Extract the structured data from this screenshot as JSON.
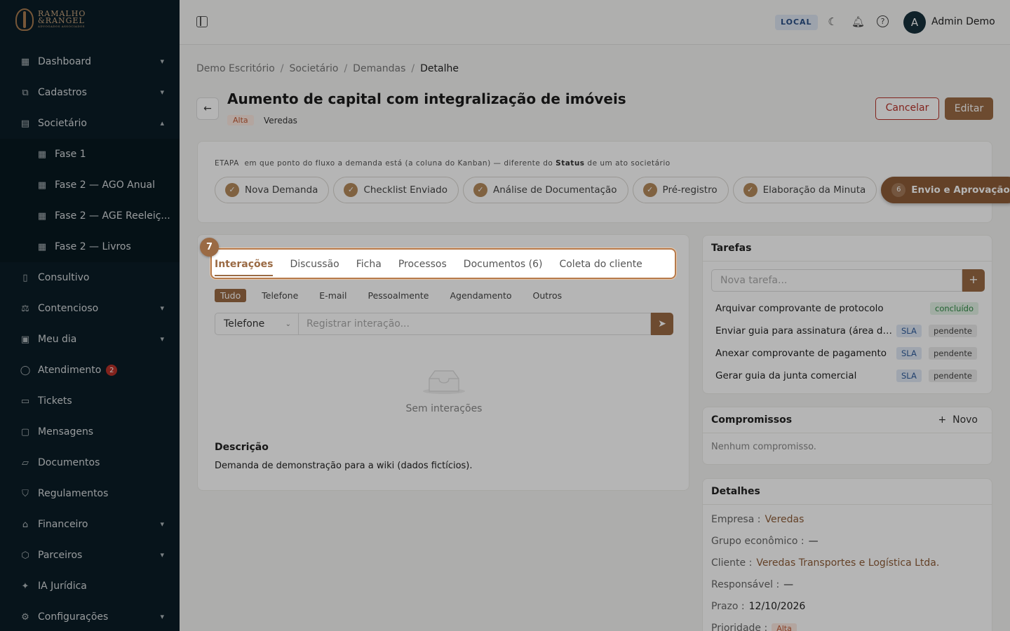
{
  "brand": {
    "line1": "RAMALHO",
    "line2": "&RANGEL",
    "tagline": "ADVOGADOS ASSOCIADOS"
  },
  "sidebar": {
    "items": [
      {
        "label": "Dashboard",
        "icon": "grid-icon",
        "chevron": "down"
      },
      {
        "label": "Cadastros",
        "icon": "boxes-icon",
        "chevron": "down"
      },
      {
        "label": "Societário",
        "icon": "building-icon",
        "chevron": "up"
      },
      {
        "label": "Fase 1",
        "icon": "grid-icon"
      },
      {
        "label": "Fase 2 — AGO Anual",
        "icon": "grid-icon"
      },
      {
        "label": "Fase 2 — AGE Reeleiç...",
        "icon": "grid-icon"
      },
      {
        "label": "Fase 2 — Livros",
        "icon": "grid-icon"
      },
      {
        "label": "Consultivo",
        "icon": "book-icon"
      },
      {
        "label": "Contencioso",
        "icon": "scale-icon",
        "chevron": "down"
      },
      {
        "label": "Meu dia",
        "icon": "calendar-icon",
        "chevron": "down"
      },
      {
        "label": "Atendimento",
        "icon": "chat-icon",
        "badge": "2"
      },
      {
        "label": "Tickets",
        "icon": "ticket-icon"
      },
      {
        "label": "Mensagens",
        "icon": "message-icon"
      },
      {
        "label": "Documentos",
        "icon": "folder-icon"
      },
      {
        "label": "Regulamentos",
        "icon": "shield-icon"
      },
      {
        "label": "Financeiro",
        "icon": "bank-icon",
        "chevron": "down"
      },
      {
        "label": "Parceiros",
        "icon": "handshake-icon",
        "chevron": "down"
      },
      {
        "label": "IA Jurídica",
        "icon": "sparkle-icon"
      },
      {
        "label": "Configurações",
        "icon": "gear-icon",
        "chevron": "down"
      }
    ]
  },
  "topbar": {
    "env": "LOCAL",
    "avatar_initial": "A",
    "user": "Admin Demo"
  },
  "breadcrumb": [
    "Demo Escritório",
    "Societário",
    "Demandas",
    "Detalhe"
  ],
  "header": {
    "title": "Aumento de capital com integralização de imóveis",
    "priority": "Alta",
    "company": "Veredas",
    "cancel": "Cancelar",
    "edit": "Editar"
  },
  "stage": {
    "note_prefix": "ETAPA",
    "note_mid": "em que ponto do fluxo a demanda está (a coluna do Kanban) — diferente do",
    "note_bold": "Status",
    "note_suffix": "de um ato societário",
    "steps": [
      {
        "label": "Nova Demanda",
        "mark": "✓"
      },
      {
        "label": "Checklist Enviado",
        "mark": "✓"
      },
      {
        "label": "Análise de Documentação",
        "mark": "✓"
      },
      {
        "label": "Pré-registro",
        "mark": "✓"
      },
      {
        "label": "Elaboração da Minuta",
        "mark": "✓"
      },
      {
        "label": "Envio e Aprovação",
        "mark": "6",
        "active": true
      }
    ]
  },
  "tabs": [
    "Interações",
    "Discussão",
    "Ficha",
    "Processos",
    "Documentos (6)",
    "Coleta do cliente"
  ],
  "tour_step": "7",
  "filters": [
    "Tudo",
    "Telefone",
    "E-mail",
    "Pessoalmente",
    "Agendamento",
    "Outros"
  ],
  "composer": {
    "channel": "Telefone",
    "placeholder": "Registrar interação..."
  },
  "empty_interactions": "Sem interações",
  "description": {
    "heading": "Descrição",
    "text": "Demanda de demonstração para a wiki (dados fictícios)."
  },
  "tasks": {
    "title": "Tarefas",
    "placeholder": "Nova tarefa...",
    "items": [
      {
        "text": "Arquivar comprovante de protocolo",
        "status": "concluído"
      },
      {
        "text": "Enviar guia para assinatura (área do cliente)",
        "sla": "SLA",
        "status": "pendente"
      },
      {
        "text": "Anexar comprovante de pagamento",
        "sla": "SLA",
        "status": "pendente"
      },
      {
        "text": "Gerar guia da junta comercial",
        "sla": "SLA",
        "status": "pendente"
      }
    ]
  },
  "appointments": {
    "title": "Compromissos",
    "new": "Novo",
    "empty": "Nenhum compromisso."
  },
  "details": {
    "title": "Detalhes",
    "rows": [
      {
        "label": "Empresa",
        "value": "Veredas"
      },
      {
        "label": "Grupo econômico",
        "value": "—"
      },
      {
        "label": "Cliente",
        "value": "Veredas Transportes e Logística Ltda."
      },
      {
        "label": "Responsável",
        "value": "—"
      },
      {
        "label": "Prazo",
        "value": "12/10/2026"
      },
      {
        "label": "Prioridade",
        "value": "Alta"
      }
    ]
  }
}
